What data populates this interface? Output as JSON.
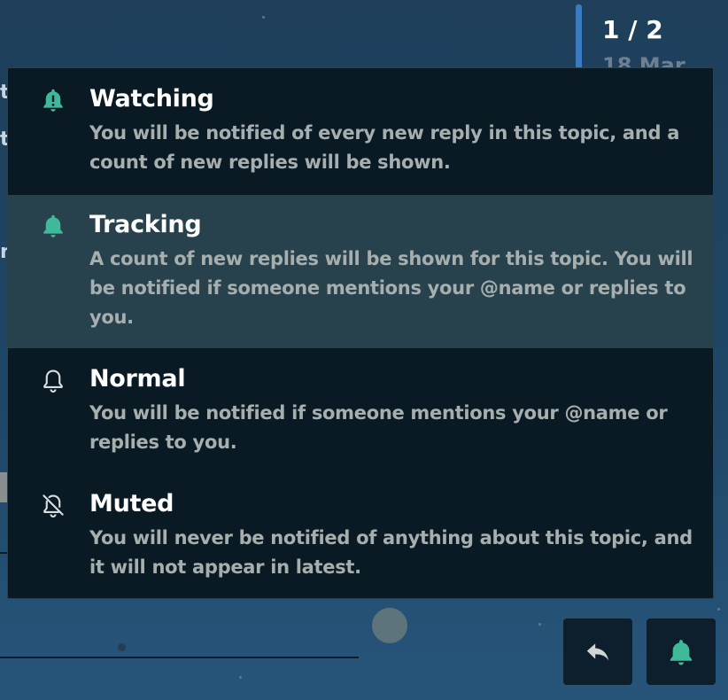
{
  "timeline": {
    "page_indicator": "1 / 2",
    "date": "18 Mar"
  },
  "notification_menu": {
    "options": [
      {
        "title": "Watching",
        "description": "You will be notified of every new reply in this topic, and a count of new replies will be shown.",
        "icon": "bell-exclamation-icon"
      },
      {
        "title": "Tracking",
        "description": "A count of new replies will be shown for this topic. You will be notified if someone mentions your @name or replies to you.",
        "icon": "bell-filled-icon",
        "selected": true
      },
      {
        "title": "Normal",
        "description": "You will be notified if someone mentions your @name or replies to you.",
        "icon": "bell-outline-icon"
      },
      {
        "title": "Muted",
        "description": "You will never be notified of anything about this topic, and it will not appear in latest.",
        "icon": "bell-slash-icon"
      }
    ]
  },
  "colors": {
    "accent": "#3fb99a",
    "menu_background": "#0a1a24",
    "selected_background": "#28424d",
    "description_text": "#a6afae"
  },
  "buttons": {
    "reply_icon": "reply-icon",
    "notification_icon": "bell-filled-icon"
  }
}
